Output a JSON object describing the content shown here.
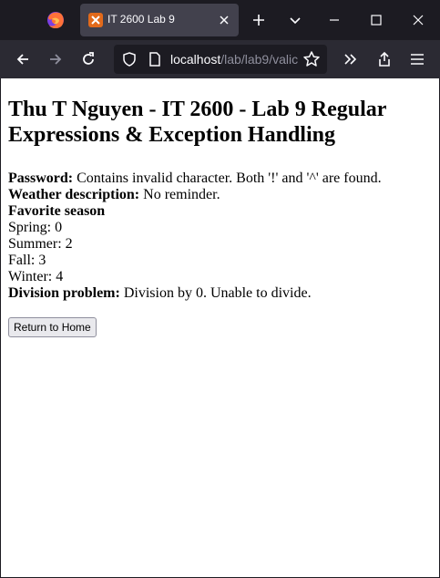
{
  "browser": {
    "tab_title": "IT 2600 Lab 9",
    "url_host": "localhost",
    "url_path": "/lab/lab9/valic"
  },
  "page": {
    "title": "Thu T Nguyen - IT 2600 - Lab 9 Regular Expressions & Exception Handling",
    "password_label": "Password:",
    "password_value": "Contains invalid character. Both '!' and '^' are found.",
    "weather_label": "Weather description:",
    "weather_value": "No reminder.",
    "season_heading": "Favorite season",
    "seasons": [
      {
        "name": "Spring",
        "count": "Spring: 0"
      },
      {
        "name": "Summer",
        "count": "Summer: 2"
      },
      {
        "name": "Fall",
        "count": "Fall: 3"
      },
      {
        "name": "Winter",
        "count": "Winter: 4"
      }
    ],
    "division_label": "Division problem:",
    "division_value": "Division by 0. Unable to divide.",
    "return_button": "Return to Home"
  }
}
